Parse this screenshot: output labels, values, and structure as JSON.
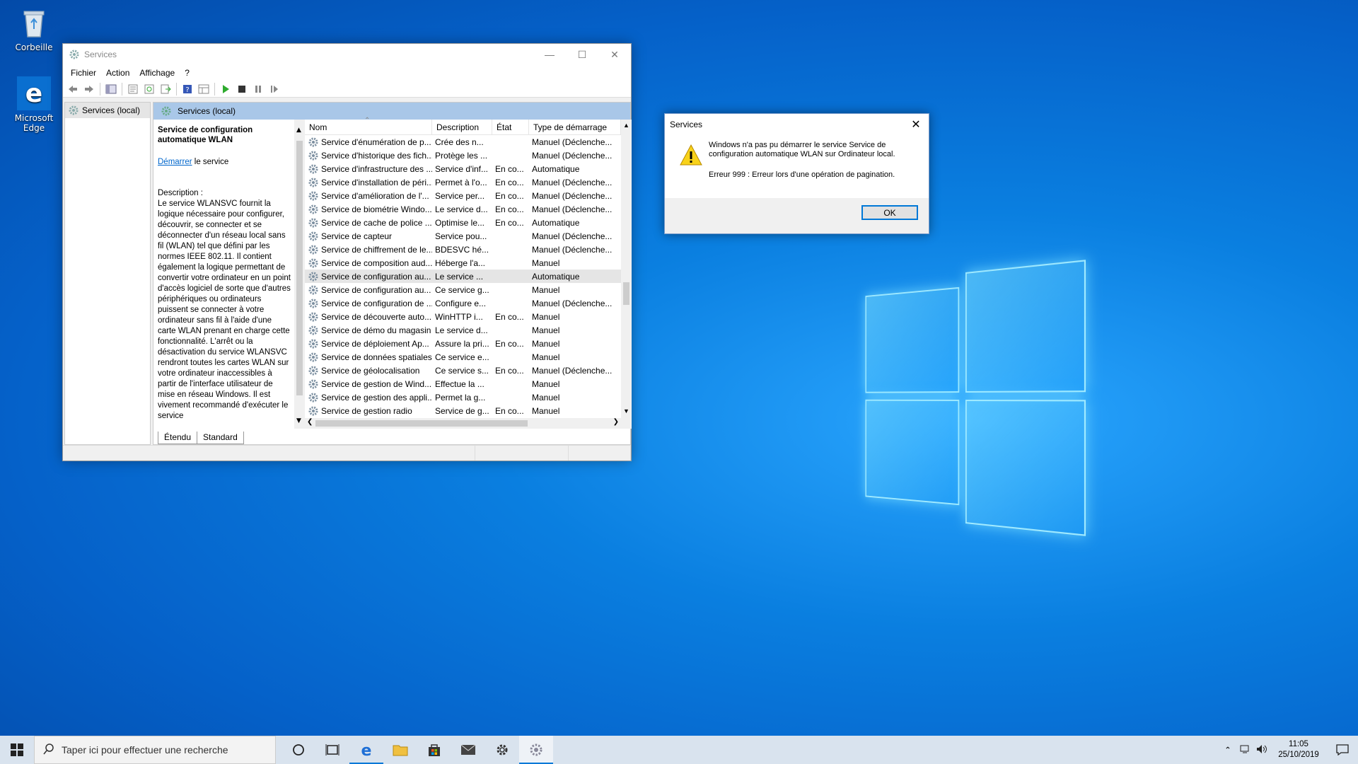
{
  "desktop": {
    "icons": [
      {
        "label": "Corbeille",
        "icon": "recycle-bin-icon"
      },
      {
        "label": "Microsoft Edge",
        "icon": "edge-icon"
      }
    ]
  },
  "window": {
    "title": "Services",
    "menu": [
      "Fichier",
      "Action",
      "Affichage",
      "?"
    ],
    "tree_root": "Services (local)",
    "panel_header": "Services (local)",
    "selected_service_title": "Service de configuration automatique WLAN",
    "start_link": "Démarrer",
    "start_suffix": " le service",
    "description_label": "Description :",
    "description_text": "Le service WLANSVC fournit la logique nécessaire pour configurer, découvrir, se connecter et se déconnecter d'un réseau local sans fil (WLAN) tel que défini par les normes IEEE 802.11. Il contient également la logique permettant de convertir votre ordinateur en un point d'accès logiciel de sorte que d'autres périphériques ou ordinateurs puissent se connecter à votre ordinateur sans fil à l'aide d'une carte WLAN prenant en charge cette fonctionnalité. L'arrêt ou la désactivation du service WLANSVC rendront toutes les cartes WLAN sur votre ordinateur inaccessibles à partir de l'interface utilisateur de mise en réseau Windows. Il est vivement recommandé d'exécuter le service",
    "columns": [
      "Nom",
      "Description",
      "État",
      "Type de démarrage"
    ],
    "rows": [
      {
        "name": "Service d'énumération de p...",
        "desc": "Crée des n...",
        "state": "",
        "start": "Manuel (Déclenche..."
      },
      {
        "name": "Service d'historique des fich...",
        "desc": "Protège les ...",
        "state": "",
        "start": "Manuel (Déclenche..."
      },
      {
        "name": "Service d'infrastructure des ...",
        "desc": "Service d'inf...",
        "state": "En co...",
        "start": "Automatique"
      },
      {
        "name": "Service d'installation de péri...",
        "desc": "Permet à l'o...",
        "state": "En co...",
        "start": "Manuel (Déclenche..."
      },
      {
        "name": "Service d'amélioration de l'...",
        "desc": "Service per...",
        "state": "En co...",
        "start": "Manuel (Déclenche..."
      },
      {
        "name": "Service de biométrie Windo...",
        "desc": "Le service d...",
        "state": "En co...",
        "start": "Manuel (Déclenche..."
      },
      {
        "name": "Service de cache de police ...",
        "desc": "Optimise le...",
        "state": "En co...",
        "start": "Automatique"
      },
      {
        "name": "Service de capteur",
        "desc": "Service pou...",
        "state": "",
        "start": "Manuel (Déclenche..."
      },
      {
        "name": "Service de chiffrement de le...",
        "desc": "BDESVC hé...",
        "state": "",
        "start": "Manuel (Déclenche..."
      },
      {
        "name": "Service de composition aud...",
        "desc": "Héberge l'a...",
        "state": "",
        "start": "Manuel"
      },
      {
        "name": "Service de configuration au...",
        "desc": "Le service ...",
        "state": "",
        "start": "Automatique"
      },
      {
        "name": "Service de configuration au...",
        "desc": "Ce service g...",
        "state": "",
        "start": "Manuel"
      },
      {
        "name": "Service de configuration de ...",
        "desc": "Configure e...",
        "state": "",
        "start": "Manuel (Déclenche..."
      },
      {
        "name": "Service de découverte auto...",
        "desc": "WinHTTP i...",
        "state": "En co...",
        "start": "Manuel"
      },
      {
        "name": "Service de démo du magasin",
        "desc": "Le service d...",
        "state": "",
        "start": "Manuel"
      },
      {
        "name": "Service de déploiement Ap...",
        "desc": "Assure la pri...",
        "state": "En co...",
        "start": "Manuel"
      },
      {
        "name": "Service de données spatiales",
        "desc": "Ce service e...",
        "state": "",
        "start": "Manuel"
      },
      {
        "name": "Service de géolocalisation",
        "desc": "Ce service s...",
        "state": "En co...",
        "start": "Manuel (Déclenche..."
      },
      {
        "name": "Service de gestion de Wind...",
        "desc": "Effectue la ...",
        "state": "",
        "start": "Manuel"
      },
      {
        "name": "Service de gestion des appli...",
        "desc": "Permet la g...",
        "state": "",
        "start": "Manuel"
      },
      {
        "name": "Service de gestion radio",
        "desc": "Service de g...",
        "state": "En co...",
        "start": "Manuel"
      }
    ],
    "selected_row": 10,
    "tabs": [
      "Étendu",
      "Standard"
    ]
  },
  "dialog": {
    "title": "Services",
    "message": "Windows n'a pas pu démarrer le service Service de configuration automatique WLAN sur Ordinateur local.",
    "error": "Erreur 999 : Erreur lors d'une opération de pagination.",
    "ok_label": "OK"
  },
  "taskbar": {
    "search_placeholder": "Taper ici pour effectuer une recherche",
    "time": "11:05",
    "date": "25/10/2019"
  },
  "colors": {
    "accent": "#0078d7",
    "panel_header": "#a9c7e8"
  }
}
